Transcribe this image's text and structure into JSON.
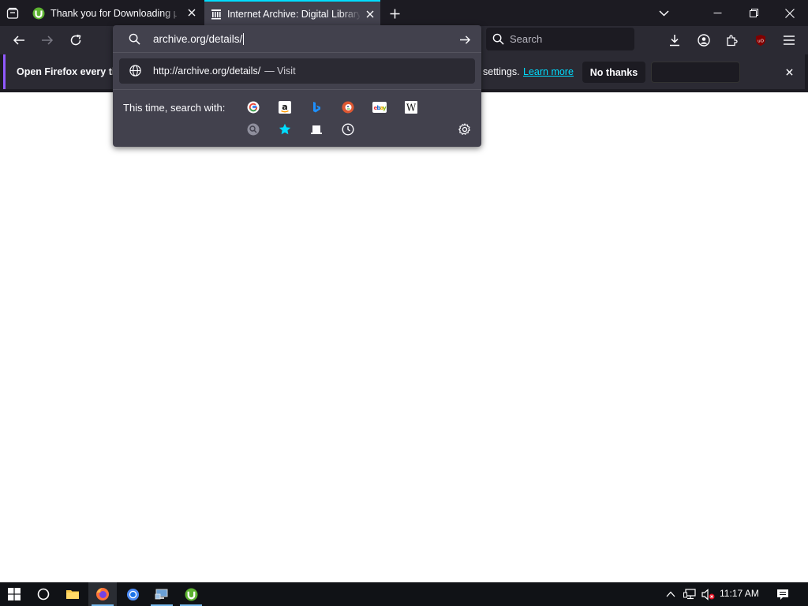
{
  "tabs": [
    {
      "title": "Thank you for Downloading µTorrent",
      "active": false
    },
    {
      "title": "Internet Archive: Digital Library of Free & Borrowable Books",
      "active": true
    }
  ],
  "urlbar": {
    "value": "archive.org/details/",
    "result_url": "http://archive.org/details/",
    "result_action": "— Visit",
    "search_with_label": "This time, search with:"
  },
  "search": {
    "placeholder": "Search"
  },
  "notification": {
    "text_left": "Open Firefox every ti",
    "text_right": "settings.",
    "learn_more": "Learn more",
    "no_thanks": "No thanks"
  },
  "taskbar": {
    "time": "11:17 AM"
  },
  "colors": {
    "accent": "#00ddff",
    "dark": "#1c1b22",
    "toolbar": "#2b2a33",
    "popup": "#42414d",
    "link": "#00ddff"
  },
  "icons": {
    "engines": [
      "google-icon",
      "amazon-icon",
      "bing-icon",
      "duckduckgo-icon",
      "ebay-icon",
      "wikipedia-icon"
    ],
    "modes": [
      "search-mode-icon",
      "bookmarks-icon",
      "tabs-icon",
      "history-icon"
    ]
  }
}
